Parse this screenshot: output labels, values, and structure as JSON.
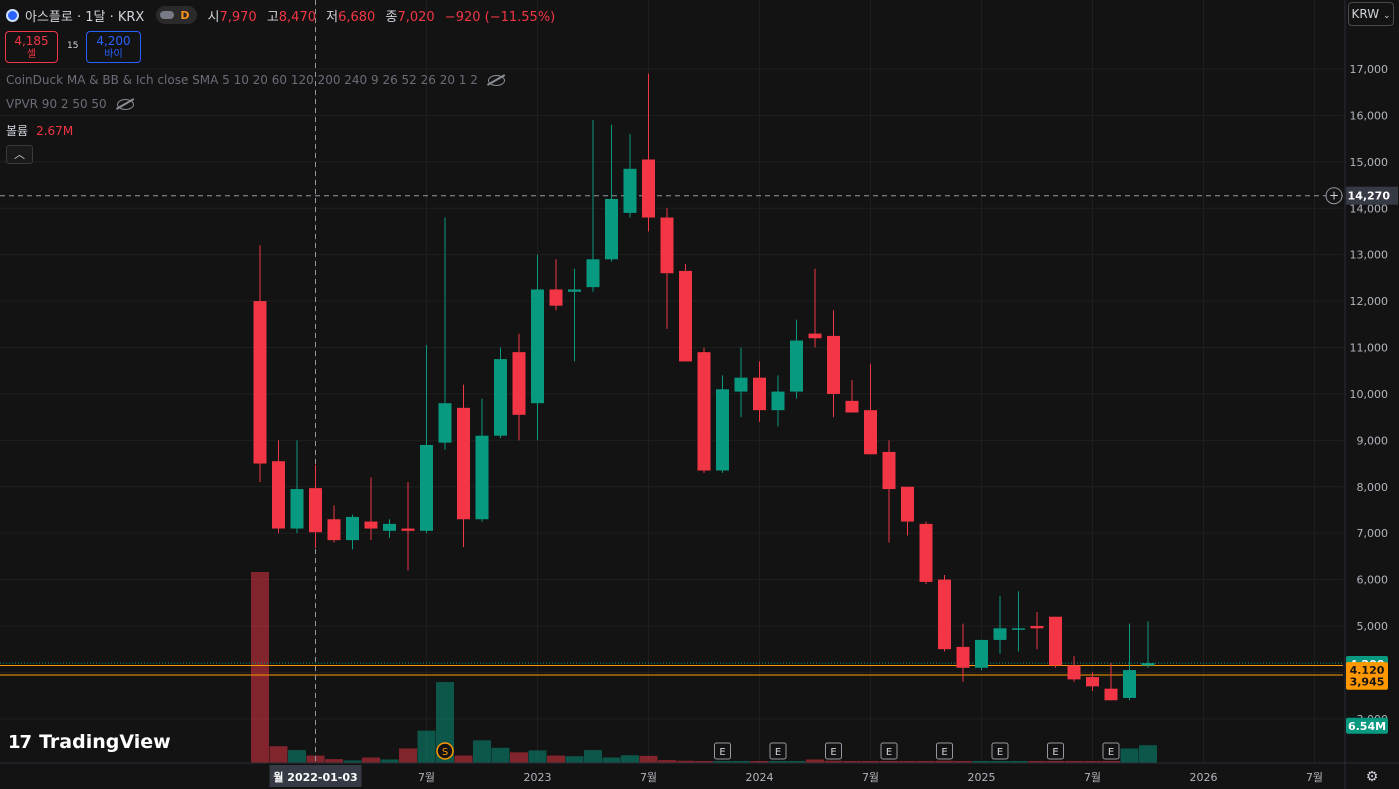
{
  "header": {
    "symbol": "아스플로 · 1달 · KRX",
    "mode": "D",
    "open_label": "시",
    "open": "7,970",
    "high_label": "고",
    "high": "8,470",
    "low_label": "저",
    "low": "6,680",
    "close_label": "종",
    "close": "7,020",
    "change": "−920 (−11.55%)"
  },
  "trade": {
    "sell_price": "4,185",
    "sell_label": "셀",
    "spread": "15",
    "buy_price": "4,200",
    "buy_label": "바이"
  },
  "indicators": {
    "line1": "CoinDuck MA & BB & Ich close SMA 5 10 20 60 120 200 240 9 26 52 26 20 1 2",
    "line2": "VPVR 90 2 50 50",
    "volume_label": "볼륨",
    "volume_value": "2.67M"
  },
  "currency": "KRW",
  "branding": "TradingView",
  "colors": {
    "up": "#089981",
    "down": "#f23645",
    "background": "#131313",
    "orange": "#ff9800"
  },
  "icons": [
    "eye-slash-icon",
    "chevron-up-icon",
    "gear-icon",
    "plus-circle-icon",
    "tradingview-logo-icon"
  ],
  "chart_data": {
    "type": "candlestick",
    "interval": "1M",
    "y_axis": {
      "range": [
        2400,
        17800
      ],
      "ticks": [
        3000,
        4000,
        5000,
        6000,
        7000,
        8000,
        9000,
        10000,
        11000,
        12000,
        13000,
        14000,
        15000,
        16000,
        17000
      ]
    },
    "x_labels": [
      {
        "label": "월 2022-01-03",
        "index": 3,
        "highlight": true
      },
      {
        "label": "7월",
        "index": 9
      },
      {
        "label": "2023",
        "index": 15
      },
      {
        "label": "7월",
        "index": 21
      },
      {
        "label": "2024",
        "index": 27
      },
      {
        "label": "7월",
        "index": 33
      },
      {
        "label": "2025",
        "index": 39
      },
      {
        "label": "7월",
        "index": 45
      },
      {
        "label": "2026",
        "index": 51
      },
      {
        "label": "7월",
        "index": 57
      }
    ],
    "candles": [
      {
        "o": 12000,
        "h": 13200,
        "l": 8100,
        "c": 8500,
        "v": 5900000
      },
      {
        "o": 8550,
        "h": 9000,
        "l": 7000,
        "c": 7100,
        "v": 520000
      },
      {
        "o": 7100,
        "h": 9000,
        "l": 7000,
        "c": 7950,
        "v": 400000
      },
      {
        "o": 7970,
        "h": 8470,
        "l": 6680,
        "c": 7020,
        "v": 230000
      },
      {
        "o": 7300,
        "h": 7600,
        "l": 6800,
        "c": 6850,
        "v": 120000
      },
      {
        "o": 6850,
        "h": 7400,
        "l": 6650,
        "c": 7350,
        "v": 80000
      },
      {
        "o": 7250,
        "h": 8200,
        "l": 6850,
        "c": 7100,
        "v": 170000
      },
      {
        "o": 7050,
        "h": 7300,
        "l": 6900,
        "c": 7200,
        "v": 110000
      },
      {
        "o": 7100,
        "h": 8100,
        "l": 6200,
        "c": 7050,
        "v": 450000
      },
      {
        "o": 7050,
        "h": 11050,
        "l": 7000,
        "c": 8900,
        "v": 1000000
      },
      {
        "o": 8950,
        "h": 13800,
        "l": 8800,
        "c": 9800,
        "v": 2500000
      },
      {
        "o": 9700,
        "h": 10200,
        "l": 6700,
        "c": 7300,
        "v": 230000
      },
      {
        "o": 7300,
        "h": 9900,
        "l": 7250,
        "c": 9100,
        "v": 700000
      },
      {
        "o": 9100,
        "h": 11000,
        "l": 9050,
        "c": 10750,
        "v": 470000
      },
      {
        "o": 10900,
        "h": 11300,
        "l": 9000,
        "c": 9550,
        "v": 330000
      },
      {
        "o": 9800,
        "h": 13000,
        "l": 9000,
        "c": 12250,
        "v": 390000
      },
      {
        "o": 12250,
        "h": 12900,
        "l": 11800,
        "c": 11900,
        "v": 230000
      },
      {
        "o": 12200,
        "h": 12700,
        "l": 10700,
        "c": 12250,
        "v": 210000
      },
      {
        "o": 12300,
        "h": 15900,
        "l": 12200,
        "c": 12900,
        "v": 400000
      },
      {
        "o": 12900,
        "h": 15800,
        "l": 12850,
        "c": 14200,
        "v": 170000
      },
      {
        "o": 13900,
        "h": 15600,
        "l": 13800,
        "c": 14850,
        "v": 240000
      },
      {
        "o": 15050,
        "h": 16900,
        "l": 13500,
        "c": 13800,
        "v": 220000
      },
      {
        "o": 13800,
        "h": 14000,
        "l": 11400,
        "c": 12600,
        "v": 90000
      },
      {
        "o": 12650,
        "h": 12800,
        "l": 10700,
        "c": 10700,
        "v": 70000
      },
      {
        "o": 10900,
        "h": 11000,
        "l": 8300,
        "c": 8350,
        "v": 50000
      },
      {
        "o": 8350,
        "h": 10400,
        "l": 8300,
        "c": 10100,
        "v": 30000
      },
      {
        "o": 10050,
        "h": 11000,
        "l": 9500,
        "c": 10350,
        "v": 25000
      },
      {
        "o": 10350,
        "h": 10700,
        "l": 9400,
        "c": 9650,
        "v": 35000
      },
      {
        "o": 9650,
        "h": 10400,
        "l": 9300,
        "c": 10050,
        "v": 40000
      },
      {
        "o": 10050,
        "h": 11600,
        "l": 9900,
        "c": 11150,
        "v": 45000
      },
      {
        "o": 11300,
        "h": 12700,
        "l": 11000,
        "c": 11200,
        "v": 110000
      },
      {
        "o": 11250,
        "h": 11800,
        "l": 9500,
        "c": 10000,
        "v": 70000
      },
      {
        "o": 9850,
        "h": 10300,
        "l": 9600,
        "c": 9600,
        "v": 35000
      },
      {
        "o": 9650,
        "h": 10650,
        "l": 8700,
        "c": 8700,
        "v": 40000
      },
      {
        "o": 8750,
        "h": 9000,
        "l": 6800,
        "c": 7950,
        "v": 60000
      },
      {
        "o": 8000,
        "h": 8000,
        "l": 6950,
        "c": 7250,
        "v": 30000
      },
      {
        "o": 7200,
        "h": 7250,
        "l": 5900,
        "c": 5950,
        "v": 40000
      },
      {
        "o": 6000,
        "h": 6100,
        "l": 4450,
        "c": 4500,
        "v": 70000
      },
      {
        "o": 4550,
        "h": 5050,
        "l": 3800,
        "c": 4100,
        "v": 50000
      },
      {
        "o": 4100,
        "h": 4700,
        "l": 4050,
        "c": 4700,
        "v": 40000
      },
      {
        "o": 4700,
        "h": 5650,
        "l": 4400,
        "c": 4950,
        "v": 50000
      },
      {
        "o": 4950,
        "h": 5750,
        "l": 4450,
        "c": 4950,
        "v": 30000
      },
      {
        "o": 5000,
        "h": 5300,
        "l": 4500,
        "c": 4950,
        "v": 60000
      },
      {
        "o": 5200,
        "h": 5200,
        "l": 4100,
        "c": 4150,
        "v": 35000
      },
      {
        "o": 4150,
        "h": 4350,
        "l": 3800,
        "c": 3850,
        "v": 25000
      },
      {
        "o": 3900,
        "h": 4000,
        "l": 3600,
        "c": 3700,
        "v": 30000
      },
      {
        "o": 3650,
        "h": 4200,
        "l": 3400,
        "c": 3400,
        "v": 40000
      },
      {
        "o": 3450,
        "h": 5050,
        "l": 3400,
        "c": 4050,
        "v": 450000
      },
      {
        "o": 4150,
        "h": 5100,
        "l": 4100,
        "c": 4200,
        "v": 550000
      }
    ],
    "earnings_markers": [
      25,
      28,
      31,
      34,
      37,
      40,
      43,
      46
    ],
    "split_marker": 10,
    "price_labels": [
      {
        "text": "4,200",
        "value": 4180,
        "bg": "#089981",
        "fg": "#ffffff"
      },
      {
        "text": "4,120",
        "value": 4050,
        "bg": "#ff9800",
        "fg": "#131313"
      },
      {
        "text": "3,945",
        "value": 3800,
        "bg": "#ff9800",
        "fg": "#131313"
      },
      {
        "text": "6.54M",
        "value": 2850,
        "bg": "#089981",
        "fg": "#ffffff"
      }
    ],
    "crosshair": {
      "price": 14270,
      "price_label": "14,270",
      "index": 3
    },
    "hlines": [
      {
        "value": 4200,
        "color": "#089981",
        "style": "dotted"
      },
      {
        "value": 4150,
        "color": "#ff9800",
        "style": "solid"
      },
      {
        "value": 3945,
        "color": "#ff9800",
        "style": "solid"
      }
    ]
  }
}
